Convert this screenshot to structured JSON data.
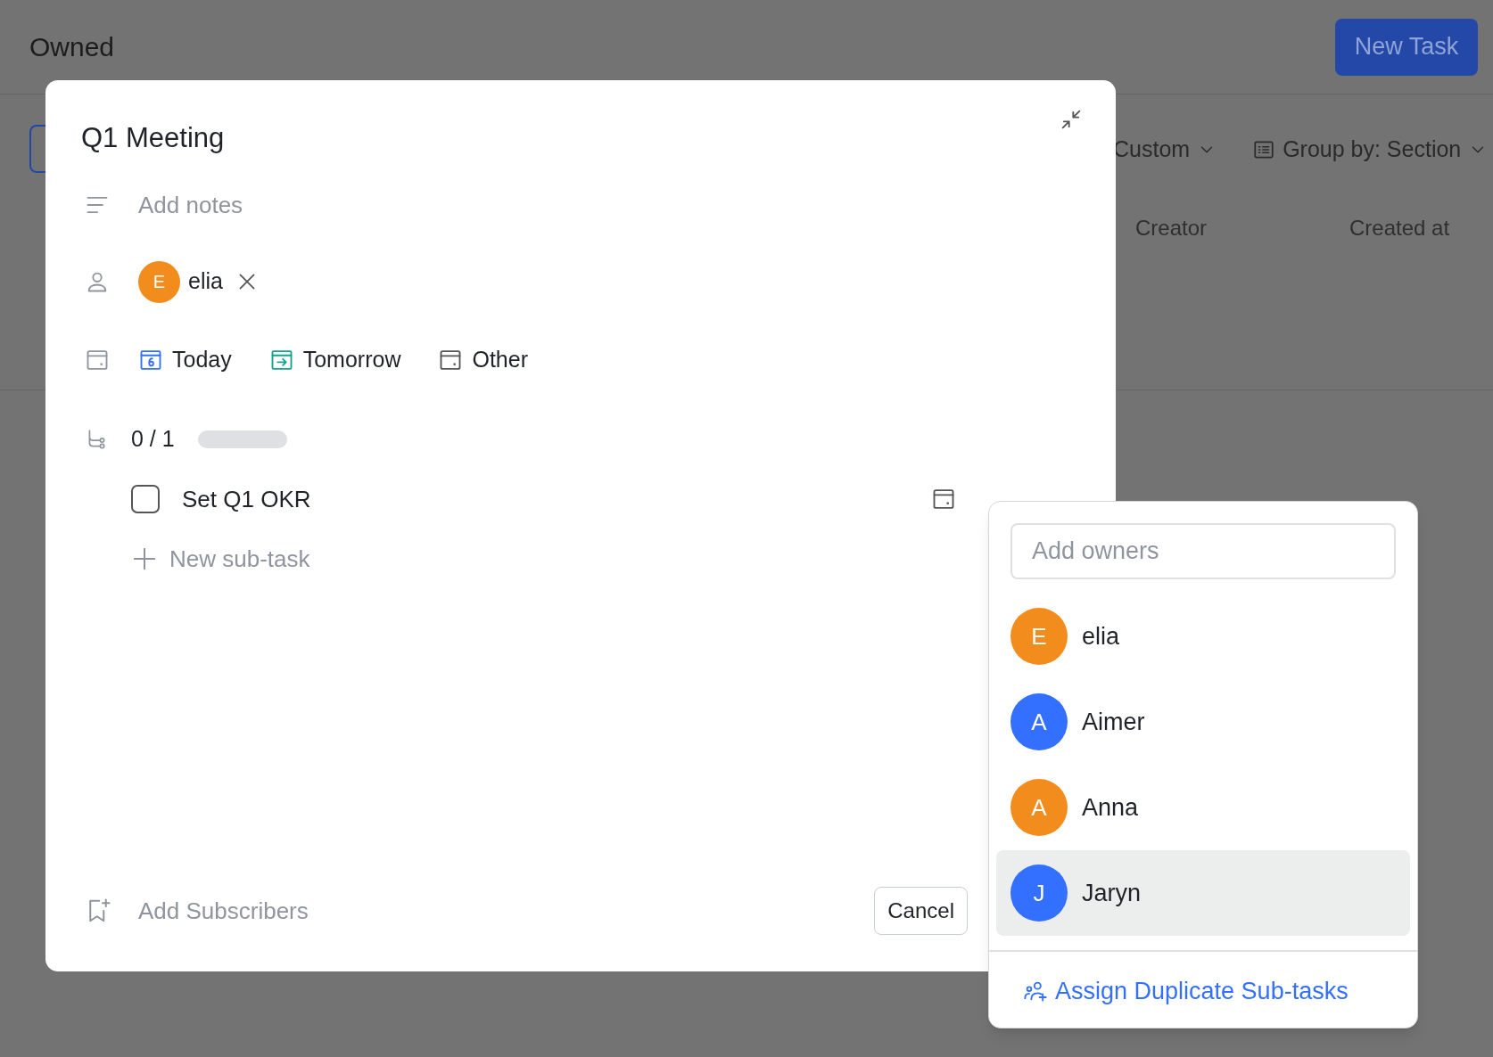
{
  "page": {
    "title": "Owned",
    "new_task_button": "New Task",
    "filters": [
      {
        "label": "Custom",
        "kind": "plain"
      },
      {
        "label": "Group by: Section",
        "kind": "group"
      }
    ],
    "columns": [
      "Creator",
      "Created at"
    ]
  },
  "task_dialog": {
    "title": "Q1 Meeting",
    "notes_placeholder": "Add notes",
    "owners": [
      {
        "initial": "E",
        "name": "elia",
        "color": "#f28c1c"
      }
    ],
    "due_options": [
      {
        "label": "Today",
        "kind": "today"
      },
      {
        "label": "Tomorrow",
        "kind": "tomorrow"
      },
      {
        "label": "Other",
        "kind": "other"
      }
    ],
    "subtask_progress": {
      "reading": "0 / 1",
      "level": 0
    },
    "subtasks": [
      {
        "title": "Set Q1 OKR",
        "checked": false
      }
    ],
    "new_subtask": "New sub-task",
    "subscribers": "Add Subscribers",
    "cancel_button": "Cancel"
  },
  "owner_picker": {
    "search_placeholder": "Add owners",
    "people": [
      {
        "initial": "E",
        "name": "elia",
        "color": "#f28c1c",
        "selected": false
      },
      {
        "initial": "A",
        "name": "Aimer",
        "color": "#3370ff",
        "selected": false
      },
      {
        "initial": "A",
        "name": "Anna",
        "color": "#f28c1c",
        "selected": false
      },
      {
        "initial": "J",
        "name": "Jaryn",
        "color": "#3370ff",
        "selected": true
      }
    ],
    "footer_action": "Assign Duplicate Sub-tasks"
  }
}
